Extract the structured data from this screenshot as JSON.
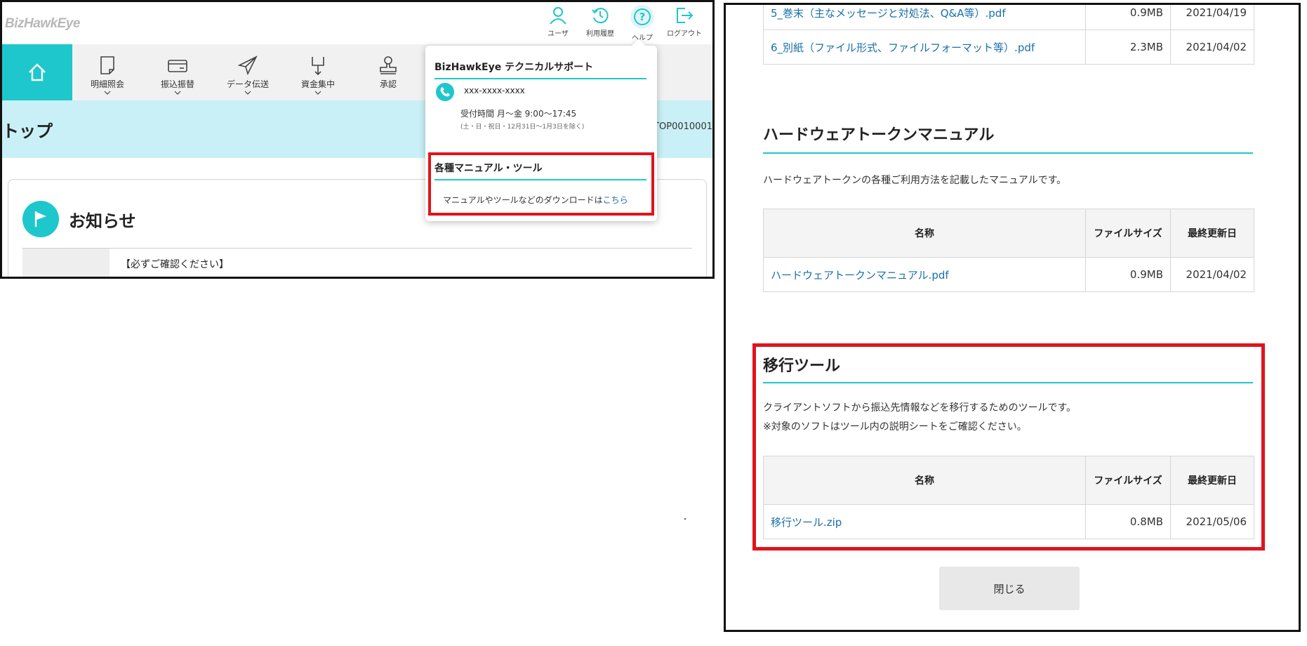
{
  "left": {
    "logo": "BizHawkEye",
    "top_icons": [
      {
        "label": "ユーザ",
        "icon": "user-icon"
      },
      {
        "label": "利用履歴",
        "icon": "history-icon"
      },
      {
        "label": "ヘルプ",
        "icon": "help-icon"
      },
      {
        "label": "ログアウト",
        "icon": "logout-icon"
      }
    ],
    "nav": [
      {
        "label": "明細照会",
        "icon": "document-icon"
      },
      {
        "label": "振込振替",
        "icon": "card-icon"
      },
      {
        "label": "データ伝送",
        "icon": "paper-plane-icon"
      },
      {
        "label": "資金集中",
        "icon": "funds-icon"
      },
      {
        "label": "承認",
        "icon": "stamp-icon"
      }
    ],
    "page_title": "トップ",
    "screen_id": "STOP0010001",
    "news_title": "お知らせ",
    "news_line": "【必ずご確認ください】",
    "popup": {
      "support_title": "BizHawkEye テクニカルサポート",
      "phone": "xxx-xxxx-xxxx",
      "hours": "受付時間 月～金 9:00～17:45",
      "holiday": "(土・日・祝日・12月31日～1月3日を除く)",
      "manual_title": "各種マニュアル・ツール",
      "manual_text": "マニュアルやツールなどのダウンロードは",
      "manual_link": "こちら"
    }
  },
  "right": {
    "top_files": [
      {
        "name": "5_巻末（主なメッセージと対処法、Q&A等）.pdf",
        "size": "0.9MB",
        "date": "2021/04/19"
      },
      {
        "name": "6_別紙（ファイル形式、ファイルフォーマット等）.pdf",
        "size": "2.3MB",
        "date": "2021/04/02"
      }
    ],
    "hw_section": {
      "title": "ハードウェアトークンマニュアル",
      "desc": "ハードウェアトークンの各種ご利用方法を記載したマニュアルです。",
      "headers": {
        "name": "名称",
        "size": "ファイルサイズ",
        "date": "最終更新日"
      },
      "files": [
        {
          "name": "ハードウェアトークンマニュアル.pdf",
          "size": "0.9MB",
          "date": "2021/04/02"
        }
      ]
    },
    "migration_section": {
      "title": "移行ツール",
      "desc1": "クライアントソフトから振込先情報などを移行するためのツールです。",
      "desc2": "※対象のソフトはツール内の説明シートをご確認ください。",
      "headers": {
        "name": "名称",
        "size": "ファイルサイズ",
        "date": "最終更新日"
      },
      "files": [
        {
          "name": "移行ツール.zip",
          "size": "0.8MB",
          "date": "2021/05/06"
        }
      ]
    },
    "close_label": "閉じる"
  },
  "colors": {
    "accent": "#1ec7cc",
    "highlight": "#e0141c",
    "link": "#1a6fa8",
    "band": "#c9f0f6"
  }
}
